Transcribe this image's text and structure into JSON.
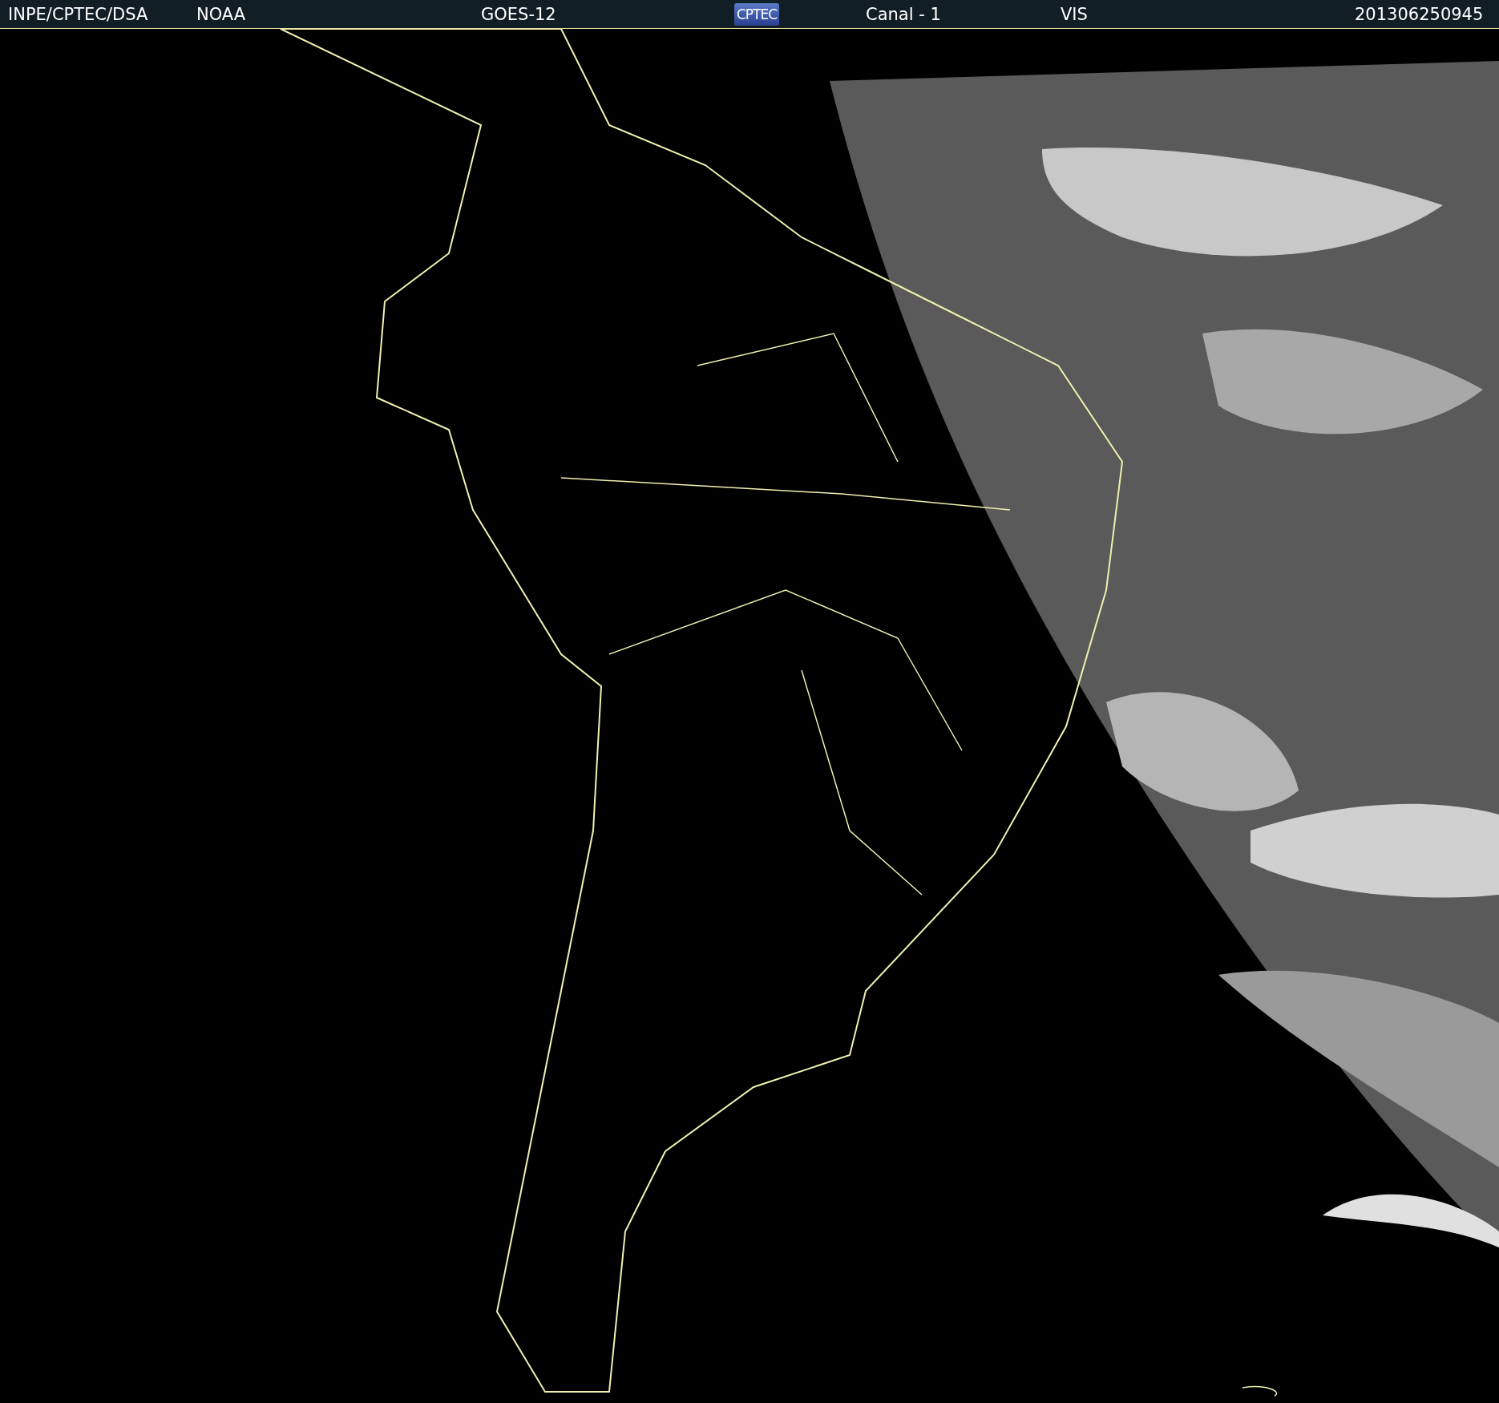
{
  "header": {
    "items": [
      {
        "kind": "text",
        "text": "INPE/CPTEC/DSA"
      },
      {
        "kind": "text",
        "text": "NOAA"
      },
      {
        "kind": "text",
        "text": "GOES-12"
      },
      {
        "kind": "logo",
        "text": "CPTEC"
      },
      {
        "kind": "text",
        "text": "Canal - 1"
      },
      {
        "kind": "text",
        "text": "VIS"
      },
      {
        "kind": "text",
        "text": "201306250945"
      }
    ]
  }
}
